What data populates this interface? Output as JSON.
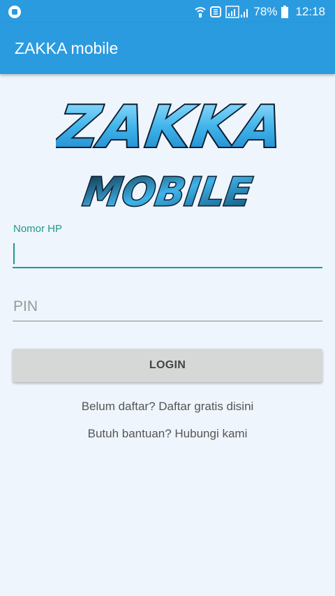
{
  "status_bar": {
    "battery_percent": "78%",
    "time": "12:18",
    "icons": [
      "notification-icon",
      "wifi-calling-icon",
      "data-icon",
      "signal-icon",
      "battery-icon"
    ]
  },
  "app_bar": {
    "title": "ZAKKA mobile"
  },
  "logo": {
    "line1": "ZAKKA",
    "line2": "MOBILE"
  },
  "form": {
    "phone_label": "Nomor HP",
    "phone_value": "",
    "pin_placeholder": "PIN",
    "login_label": "LOGIN"
  },
  "links": {
    "register": "Belum daftar? Daftar gratis disini",
    "help": "Butuh bantuan? Hubungi kami"
  },
  "colors": {
    "primary": "#2b9be0",
    "accent": "#1e9a8e",
    "background": "#eef5fc",
    "button": "#d6d7d7"
  }
}
